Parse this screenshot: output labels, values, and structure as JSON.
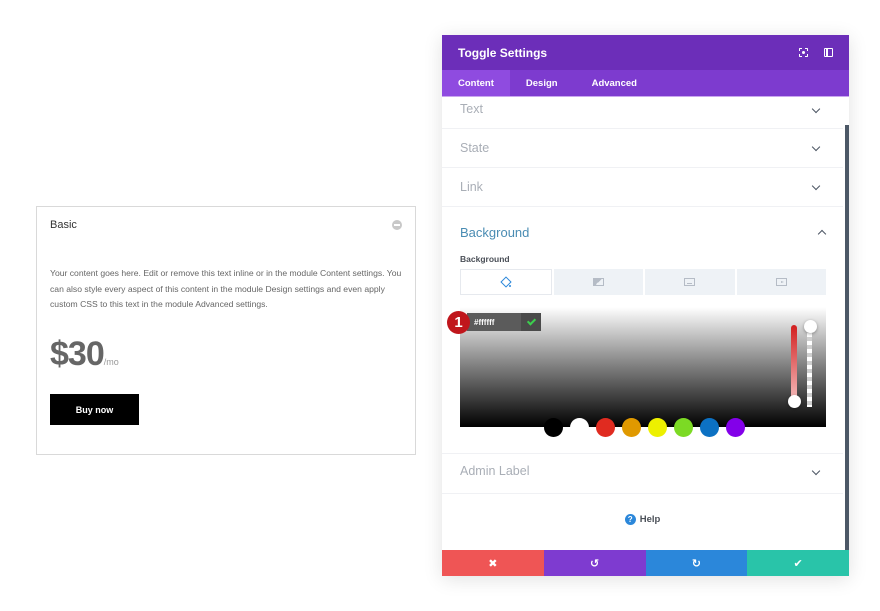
{
  "preview_card": {
    "title": "Basic",
    "body": "Your content goes here. Edit or remove this text inline or in the module Content settings. You can also style every aspect of this content in the module Design settings and even apply custom CSS to this text in the module Advanced settings.",
    "price": "$30",
    "per": "/mo",
    "button_label": "Buy now"
  },
  "modal": {
    "title": "Toggle Settings",
    "header_icons": [
      "expand-icon",
      "sidebar-toggle-icon"
    ],
    "tabs": [
      {
        "label": "Content",
        "active": true
      },
      {
        "label": "Design",
        "active": false
      },
      {
        "label": "Advanced",
        "active": false
      }
    ],
    "sections": [
      {
        "label": "Text",
        "expanded": false
      },
      {
        "label": "State",
        "expanded": false
      },
      {
        "label": "Link",
        "expanded": false
      },
      {
        "label": "Background",
        "expanded": true
      },
      {
        "label": "Admin Label",
        "expanded": false
      }
    ],
    "background": {
      "field_label": "Background",
      "type_tabs": [
        {
          "icon": "paint-bucket-icon",
          "active": true
        },
        {
          "icon": "gradient-icon",
          "active": false
        },
        {
          "icon": "image-icon",
          "active": false
        },
        {
          "icon": "video-icon",
          "active": false
        }
      ],
      "color_picker": {
        "hex_value": "#ffffff",
        "step_badge": "1",
        "swatches": [
          "#000000",
          "#ffffff",
          "#e02b20",
          "#e09900",
          "#edf000",
          "#7cda24",
          "#0c71c3",
          "#8300e9"
        ]
      }
    },
    "help_label": "Help",
    "footer": {
      "cancel": {
        "icon": "close-icon",
        "glyph": "✖",
        "color": "#ef5555"
      },
      "undo": {
        "icon": "undo-icon",
        "glyph": "↺",
        "color": "#7e3bd0"
      },
      "redo": {
        "icon": "redo-icon",
        "glyph": "↻",
        "color": "#2b87da"
      },
      "save": {
        "icon": "check-icon",
        "glyph": "✔",
        "color": "#29c4a9"
      }
    }
  }
}
